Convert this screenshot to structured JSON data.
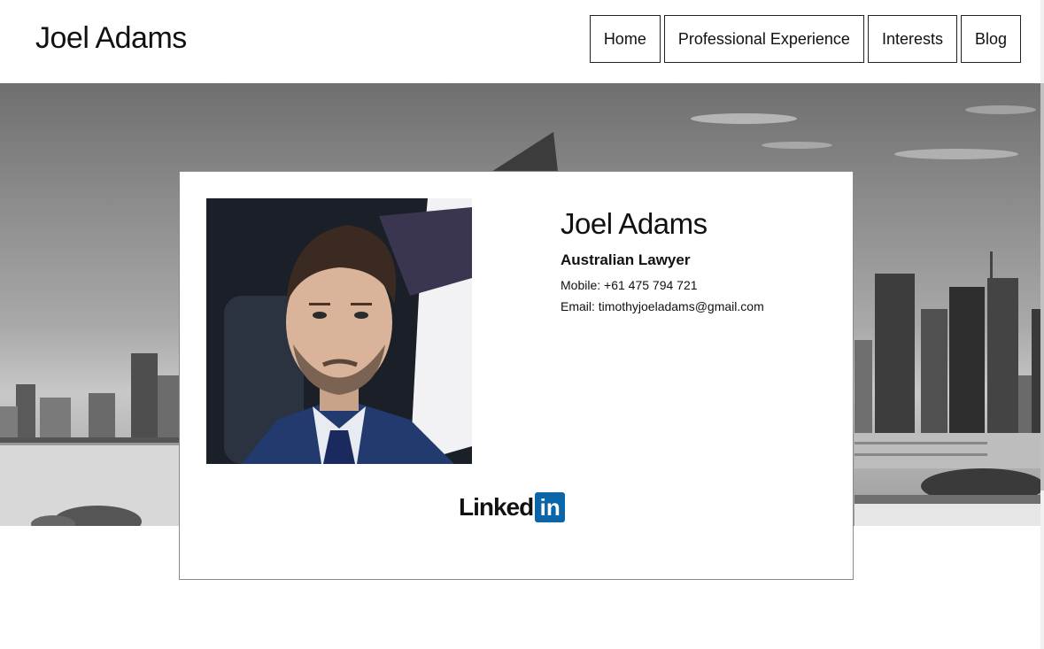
{
  "header": {
    "site_title": "Joel Adams",
    "nav": [
      "Home",
      "Professional Experience",
      "Interests",
      "Blog"
    ]
  },
  "profile": {
    "name": "Joel Adams",
    "role": "Australian Lawyer",
    "mobile": "Mobile: +61 475 794 721",
    "email": "Email: timothyjoeladams@gmail.com"
  },
  "social": {
    "linkedin_text": "Linked",
    "linkedin_badge": "in",
    "linkedin_color": "#0a66a8"
  },
  "icons": [
    "linkedin-icon"
  ],
  "colors": {
    "background": "#ffffff",
    "border": "#222222"
  }
}
